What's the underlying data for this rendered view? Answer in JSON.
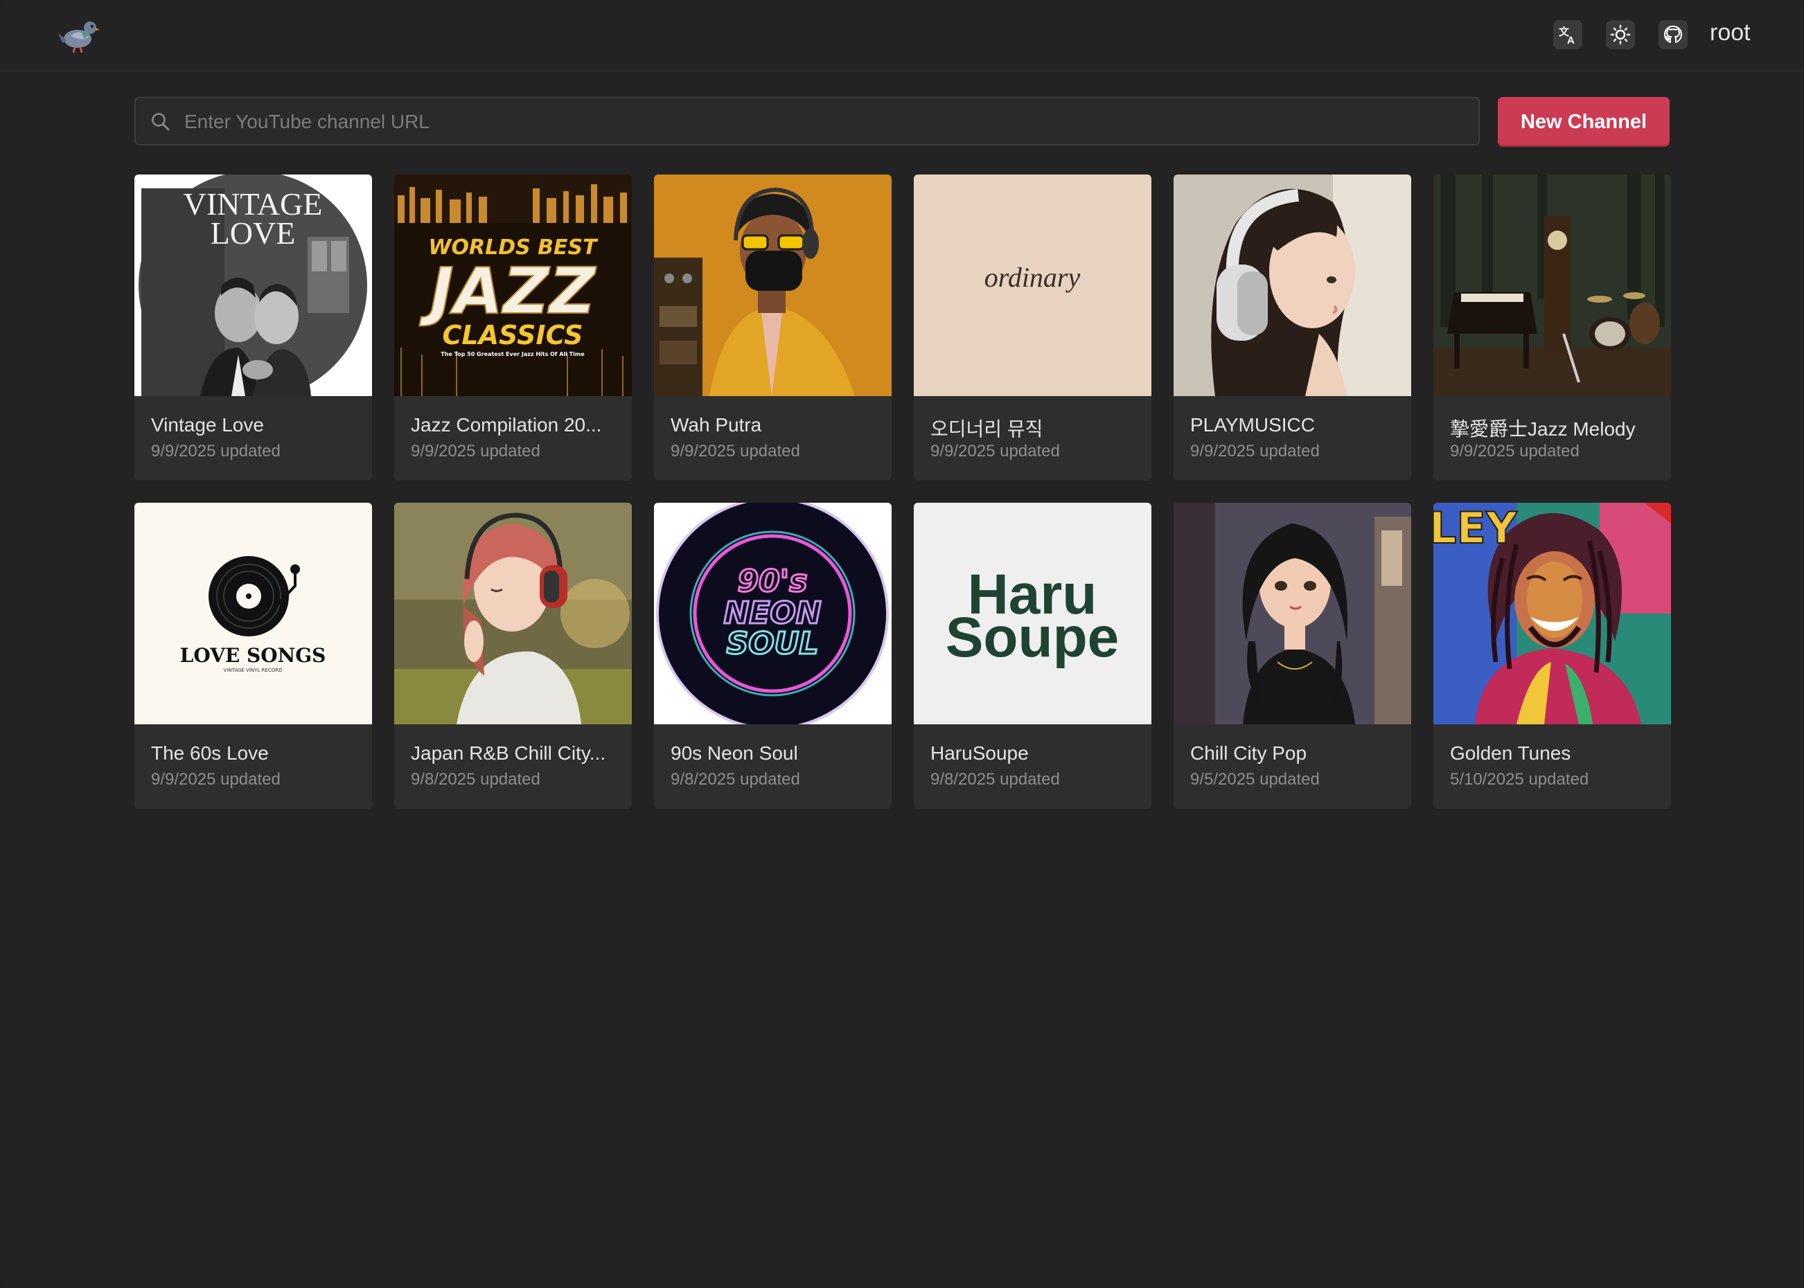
{
  "header": {
    "user": "root",
    "icons": [
      "pigeon-logo",
      "translate-icon",
      "sun-icon",
      "github-icon"
    ]
  },
  "search": {
    "placeholder": "Enter YouTube channel URL",
    "button_label": "New Channel",
    "button_color": "#cc3b54"
  },
  "channels": [
    {
      "title": "Vintage Love",
      "updated": "9/9/2025 updated",
      "art_text": [
        "VINTAGE",
        "LOVE"
      ]
    },
    {
      "title": "Jazz Compilation 20...",
      "updated": "9/9/2025 updated",
      "art_text": [
        "WORLDS BEST",
        "JAZZ",
        "CLASSICS",
        "The Top 50 Greatest Ever Jazz Hits Of All Time"
      ]
    },
    {
      "title": "Wah Putra",
      "updated": "9/9/2025 updated"
    },
    {
      "title": "오디너리 뮤직",
      "updated": "9/9/2025 updated",
      "art_text": [
        "ordinary"
      ]
    },
    {
      "title": "PLAYMUSICC",
      "updated": "9/9/2025 updated"
    },
    {
      "title": "摯愛爵士Jazz Melody",
      "updated": "9/9/2025 updated"
    },
    {
      "title": "The 60s Love",
      "updated": "9/9/2025 updated",
      "art_text": [
        "LOVE SONGS",
        "VINTAGE VINYL RECORD"
      ]
    },
    {
      "title": "Japan R&B Chill City...",
      "updated": "9/8/2025 updated"
    },
    {
      "title": "90s Neon Soul",
      "updated": "9/8/2025 updated",
      "art_text": [
        "90's",
        "NEON",
        "SOUL"
      ]
    },
    {
      "title": "HaruSoupe",
      "updated": "9/8/2025 updated",
      "art_text": [
        "Haru",
        "Soupe"
      ]
    },
    {
      "title": "Chill City Pop",
      "updated": "9/5/2025 updated"
    },
    {
      "title": "Golden Tunes",
      "updated": "5/10/2025 updated",
      "art_text": [
        "LEY"
      ]
    }
  ]
}
